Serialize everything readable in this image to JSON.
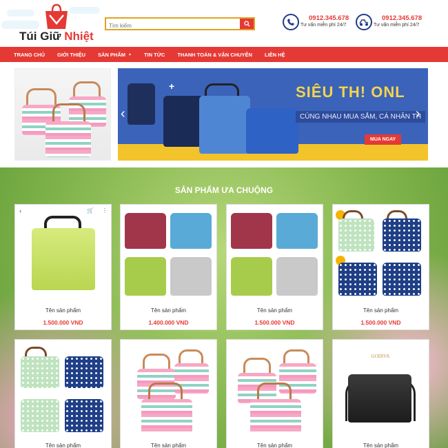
{
  "brand": {
    "name_part1": "Túi Giữ ",
    "name_part2": "Nhiệt"
  },
  "search": {
    "placeholder": "Tìm kiếm"
  },
  "contacts": [
    {
      "icon": "phone-icon",
      "phone": "0912.345.678",
      "note": "Tư vấn miễn phí 24/7"
    },
    {
      "icon": "delivery-icon",
      "phone": "0912.345.678",
      "note": "Tư vấn miễn phí 24/7"
    }
  ],
  "nav": {
    "items": [
      {
        "label": "TRANG CHỦ"
      },
      {
        "label": "GIỚI THIỆU"
      },
      {
        "label": "SẢN PHẨM",
        "has_dropdown": true
      },
      {
        "label": "TIN TỨC"
      },
      {
        "label": "THANH TOÁN & VẬN CHUYỂN"
      },
      {
        "label": "LIÊN HỆ"
      }
    ]
  },
  "slider": {
    "title": "SIÊU TH! ONL",
    "tagline": "CÙNG NHAU MUA SẮM, CÁ NHÂN TH",
    "cta": "MUA NGAY",
    "prev_icon": "chevron-left-icon",
    "next_icon": "chevron-right-icon"
  },
  "section": {
    "title": "SẢN PHẨM ƯA CHUỘNG"
  },
  "products": [
    {
      "name": "Tên sản phẩm",
      "price": "1.500.000 VND",
      "image": "green-cooler-bag"
    },
    {
      "name": "Tên sản phẩm",
      "price": "1.400.000 VND",
      "image": "colored-lunch-bags"
    },
    {
      "name": "Tên sản phẩm",
      "price": "1.500.000 VND",
      "image": "colored-lunch-bags"
    },
    {
      "name": "Tên sản phẩm",
      "price": "1.500.000 VND",
      "image": "navy-polka-dot-bags"
    },
    {
      "name": "Tên sản phẩm",
      "price": "",
      "image": "green-navy-dot-bags"
    },
    {
      "name": "Tên sản phẩm",
      "price": "",
      "image": "striped-bags"
    },
    {
      "name": "Tên sản phẩm",
      "price": "",
      "image": "striped-bags"
    },
    {
      "name": "Tên sản phẩm",
      "price": "",
      "image": "godiva-black-bag",
      "brand_text": "GODIVA"
    }
  ],
  "colors": {
    "accent": "#e53935",
    "nav_bg": "#e53935",
    "price": "#e53935",
    "slider_bg": "#3b63b9"
  }
}
